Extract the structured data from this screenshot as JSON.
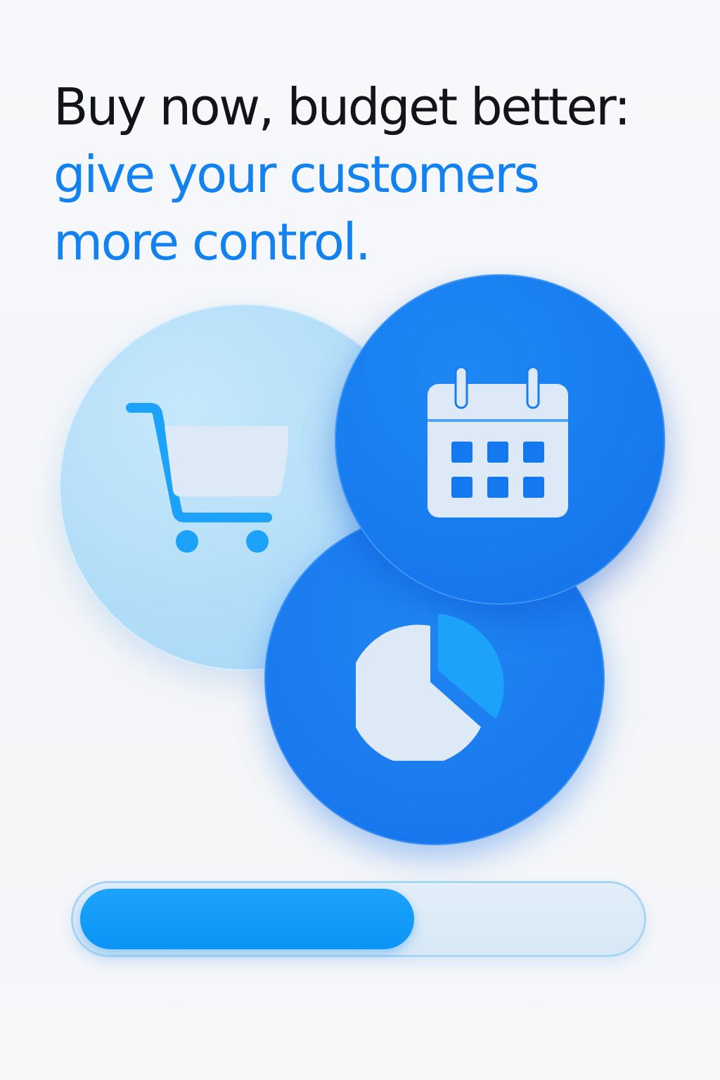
{
  "headline": {
    "line1": "Buy now, budget better:",
    "line2": "give your customers",
    "line3": "more control."
  },
  "icons": {
    "cart": "shopping-cart-icon",
    "calendar": "calendar-icon",
    "pie": "pie-chart-icon"
  },
  "progress": {
    "fraction": 0.6
  },
  "colors": {
    "text_dark": "#111418",
    "accent_blue": "#1282f0",
    "circle_dark_blue": "#187cef",
    "circle_light_blue": "#b2ddf8",
    "icon_fill": "#dde9f6",
    "icon_accent": "#1ca2f8",
    "progress_fill": "#0b94f6",
    "progress_track": "#dbeaf7"
  }
}
